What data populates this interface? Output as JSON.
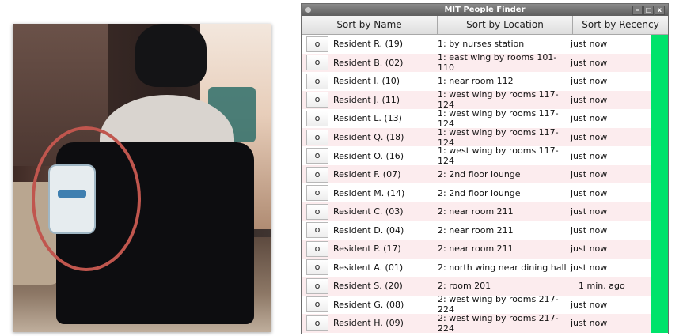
{
  "window": {
    "title": "MIT People Finder",
    "controls": [
      "–",
      "□",
      "x"
    ]
  },
  "sort_buttons": {
    "name": "Sort by Name",
    "location": "Sort by Location",
    "recency": "Sort by Recency"
  },
  "status_color": "#00e36b",
  "rows": [
    {
      "button": "o",
      "name": "Resident R. (19)",
      "location": "1: by nurses station",
      "recency": "just now"
    },
    {
      "button": "o",
      "name": "Resident B. (02)",
      "location": "1: east wing by rooms 101-110",
      "recency": "just now"
    },
    {
      "button": "o",
      "name": "Resident I. (10)",
      "location": "1: near room 112",
      "recency": "just now"
    },
    {
      "button": "o",
      "name": "Resident J. (11)",
      "location": "1: west wing by rooms 117-124",
      "recency": "just now"
    },
    {
      "button": "o",
      "name": "Resident L. (13)",
      "location": "1: west wing by rooms 117-124",
      "recency": "just now"
    },
    {
      "button": "o",
      "name": "Resident Q. (18)",
      "location": "1: west wing by rooms 117-124",
      "recency": "just now"
    },
    {
      "button": "o",
      "name": "Resident O. (16)",
      "location": "1: west wing by rooms 117-124",
      "recency": "just now"
    },
    {
      "button": "o",
      "name": "Resident F. (07)",
      "location": "2: 2nd floor lounge",
      "recency": "just now"
    },
    {
      "button": "o",
      "name": "Resident M. (14)",
      "location": "2: 2nd floor lounge",
      "recency": "just now"
    },
    {
      "button": "o",
      "name": "Resident C. (03)",
      "location": "2: near room 211",
      "recency": "just now"
    },
    {
      "button": "o",
      "name": "Resident D. (04)",
      "location": "2: near room 211",
      "recency": "just now"
    },
    {
      "button": "o",
      "name": "Resident P. (17)",
      "location": "2: near room 211",
      "recency": "just now"
    },
    {
      "button": "o",
      "name": "Resident A. (01)",
      "location": "2: north wing near dining hall",
      "recency": "just now"
    },
    {
      "button": "o",
      "name": "Resident S. (20)",
      "location": "2: room 201",
      "recency": "1 min. ago"
    },
    {
      "button": "o",
      "name": "Resident G. (08)",
      "location": "2: west wing by rooms 217-224",
      "recency": "just now"
    },
    {
      "button": "o",
      "name": "Resident H. (09)",
      "location": "2: west wing by rooms 217-224",
      "recency": "just now"
    }
  ]
}
